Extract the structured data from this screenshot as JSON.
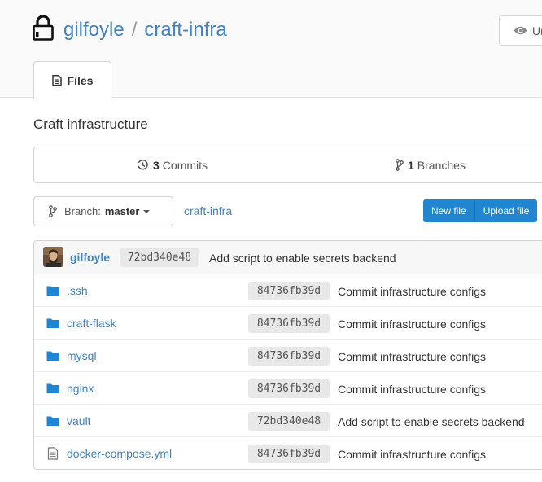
{
  "repo": {
    "owner": "gilfoyle",
    "separator": "/",
    "name": "craft-infra",
    "description": "Craft infrastructure"
  },
  "watch": {
    "label": "Un"
  },
  "tabs": [
    {
      "label": "Files",
      "icon": "file-text-icon"
    }
  ],
  "stats": {
    "commits": {
      "count": "3",
      "label": "Commits"
    },
    "branches": {
      "count": "1",
      "label": "Branches"
    }
  },
  "branch": {
    "prefix": "Branch:",
    "name": "master"
  },
  "breadcrumb": "craft-infra",
  "actions": {
    "new_file": "New file",
    "upload_file": "Upload file"
  },
  "latest_commit": {
    "author": "gilfoyle",
    "sha": "72bd340e48",
    "message": "Add script to enable secrets backend"
  },
  "files": [
    {
      "name": ".ssh",
      "type": "folder",
      "sha": "84736fb39d",
      "message": "Commit infrastructure configs"
    },
    {
      "name": "craft-flask",
      "type": "folder",
      "sha": "84736fb39d",
      "message": "Commit infrastructure configs"
    },
    {
      "name": "mysql",
      "type": "folder",
      "sha": "84736fb39d",
      "message": "Commit infrastructure configs"
    },
    {
      "name": "nginx",
      "type": "folder",
      "sha": "84736fb39d",
      "message": "Commit infrastructure configs"
    },
    {
      "name": "vault",
      "type": "folder",
      "sha": "72bd340e48",
      "message": "Add script to enable secrets backend"
    },
    {
      "name": "docker-compose.yml",
      "type": "file",
      "sha": "84736fb39d",
      "message": "Commit infrastructure configs"
    }
  ],
  "colors": {
    "link": "#4183c4",
    "primary": "#2185d0",
    "border": "#d4d4d5"
  }
}
